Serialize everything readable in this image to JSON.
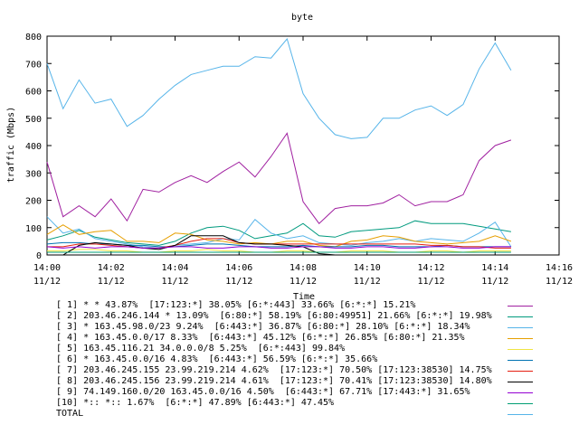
{
  "chart_data": {
    "type": "line",
    "title": "byte",
    "xlabel": "Time",
    "ylabel": "traffic (Mbps)",
    "ylim": [
      0,
      800
    ],
    "yticks": [
      0,
      100,
      200,
      300,
      400,
      500,
      600,
      700,
      800
    ],
    "xlim_minutes": [
      0,
      16
    ],
    "xticks": [
      {
        "time": "14:00",
        "date": "11/12"
      },
      {
        "time": "14:02",
        "date": "11/12"
      },
      {
        "time": "14:04",
        "date": "11/12"
      },
      {
        "time": "14:06",
        "date": "11/12"
      },
      {
        "time": "14:08",
        "date": "11/12"
      },
      {
        "time": "14:10",
        "date": "11/12"
      },
      {
        "time": "14:12",
        "date": "11/12"
      },
      {
        "time": "14:14",
        "date": "11/12"
      },
      {
        "time": "14:16",
        "date": "11/12"
      }
    ],
    "grid": false,
    "legend_position": "bottom",
    "x_minutes": [
      0,
      0.5,
      1,
      1.5,
      2,
      2.5,
      3,
      3.5,
      4,
      4.5,
      5,
      5.5,
      6,
      6.5,
      7,
      7.5,
      8,
      8.5,
      9,
      9.5,
      10,
      10.5,
      11,
      11.5,
      12,
      12.5,
      13,
      13.5,
      14,
      14.5,
      15
    ],
    "series": [
      {
        "name": "[ 1] * * 43.87%  [17:123:*] 38.05% [6:*:443] 33.66% [6:*:*] 15.21%",
        "color": "#a020a0",
        "values": [
          340,
          140,
          180,
          140,
          205,
          125,
          240,
          230,
          265,
          290,
          265,
          305,
          340,
          285,
          360,
          445,
          195,
          115,
          170,
          180,
          180,
          190,
          220,
          180,
          195,
          195,
          220,
          345,
          400,
          420,
          null
        ]
      },
      {
        "name": "[ 2] 203.46.246.144 * 13.09%  [6:80:*] 58.19% [6:80:49951] 21.66% [6:*:*] 19.98%",
        "color": "#009a7e",
        "values": [
          55,
          70,
          90,
          65,
          55,
          45,
          40,
          35,
          50,
          80,
          100,
          105,
          90,
          60,
          70,
          80,
          115,
          70,
          65,
          85,
          90,
          95,
          100,
          125,
          115,
          115,
          115,
          105,
          95,
          85,
          null
        ]
      },
      {
        "name": "[ 3] * 163.45.98.0/23 9.24%  [6:443:*] 36.87% [6:80:*] 28.10% [6:*:*] 18.34%",
        "color": "#56b4e9",
        "values": [
          140,
          80,
          95,
          60,
          50,
          40,
          30,
          25,
          35,
          40,
          45,
          60,
          55,
          130,
          80,
          60,
          70,
          45,
          40,
          35,
          45,
          50,
          60,
          50,
          60,
          55,
          50,
          80,
          120,
          30,
          null
        ]
      },
      {
        "name": "[ 4] * 163.45.0.0/17 8.33%  [6:443:*] 45.12% [6:*:*] 26.85% [6:80:*] 21.35%",
        "color": "#e69f00",
        "values": [
          75,
          110,
          75,
          85,
          90,
          50,
          50,
          45,
          80,
          75,
          55,
          50,
          40,
          45,
          40,
          50,
          50,
          35,
          30,
          50,
          55,
          70,
          65,
          50,
          45,
          40,
          45,
          50,
          70,
          50,
          null
        ]
      },
      {
        "name": "[ 5] 163.45.116.21 34.0.0.0/8 5.25%  [6:*:443] 99.84%",
        "color": "#f0e442",
        "values": [
          15,
          15,
          20,
          20,
          15,
          15,
          10,
          10,
          15,
          15,
          20,
          15,
          15,
          10,
          10,
          15,
          15,
          10,
          10,
          15,
          15,
          15,
          10,
          10,
          15,
          15,
          10,
          15,
          15,
          15,
          null
        ]
      },
      {
        "name": "[ 6] * 163.45.0.0/16 4.83%  [6:443:*] 56.59% [6:*:*] 35.66%",
        "color": "#0072b2",
        "values": [
          40,
          45,
          45,
          40,
          40,
          35,
          35,
          30,
          30,
          35,
          40,
          40,
          35,
          30,
          30,
          30,
          35,
          30,
          30,
          30,
          35,
          35,
          30,
          30,
          30,
          35,
          30,
          30,
          30,
          30,
          null
        ]
      },
      {
        "name": "[ 7] 203.46.245.155 23.99.219.214 4.62%  [17:123:*] 70.50% [17:123:38530] 14.75%",
        "color": "#e51e10",
        "values": [
          30,
          30,
          40,
          40,
          35,
          30,
          25,
          25,
          35,
          50,
          60,
          60,
          45,
          40,
          40,
          40,
          40,
          40,
          40,
          40,
          40,
          40,
          40,
          40,
          35,
          35,
          30,
          30,
          25,
          25,
          null
        ]
      },
      {
        "name": "[ 8] 203.46.245.156 23.99.219.214 4.61%  [17:123:*] 70.41% [17:123:38530] 14.80%",
        "color": "#000000",
        "values": [
          0,
          0,
          35,
          45,
          40,
          35,
          25,
          20,
          35,
          70,
          70,
          70,
          45,
          40,
          40,
          35,
          30,
          5,
          0,
          0,
          0,
          0,
          0,
          0,
          0,
          0,
          0,
          0,
          0,
          0,
          null
        ]
      },
      {
        "name": "[ 9] 74.149.160.0/20 163.45.0.0/16 4.50%  [6:443:*] 67.71% [17:443:*] 31.65%",
        "color": "#9400d3",
        "values": [
          30,
          25,
          30,
          25,
          30,
          30,
          25,
          25,
          30,
          30,
          25,
          25,
          30,
          30,
          25,
          25,
          30,
          30,
          25,
          25,
          30,
          30,
          25,
          25,
          30,
          30,
          25,
          25,
          30,
          30,
          null
        ]
      },
      {
        "name": "[10] *:: *:: 1.67%  [6:*:*] 47.89% [6:443:*] 47.45%",
        "color": "#009e73",
        "values": [
          10,
          10,
          10,
          10,
          10,
          10,
          10,
          10,
          10,
          10,
          10,
          10,
          10,
          10,
          10,
          10,
          10,
          10,
          10,
          10,
          10,
          10,
          10,
          10,
          10,
          10,
          10,
          10,
          10,
          10,
          null
        ]
      },
      {
        "name": "TOTAL",
        "color": "#56b4e9",
        "values": [
          700,
          535,
          640,
          555,
          570,
          470,
          510,
          570,
          620,
          660,
          675,
          690,
          690,
          725,
          720,
          790,
          590,
          500,
          440,
          425,
          430,
          500,
          500,
          530,
          545,
          510,
          550,
          680,
          775,
          675,
          null
        ]
      }
    ]
  }
}
